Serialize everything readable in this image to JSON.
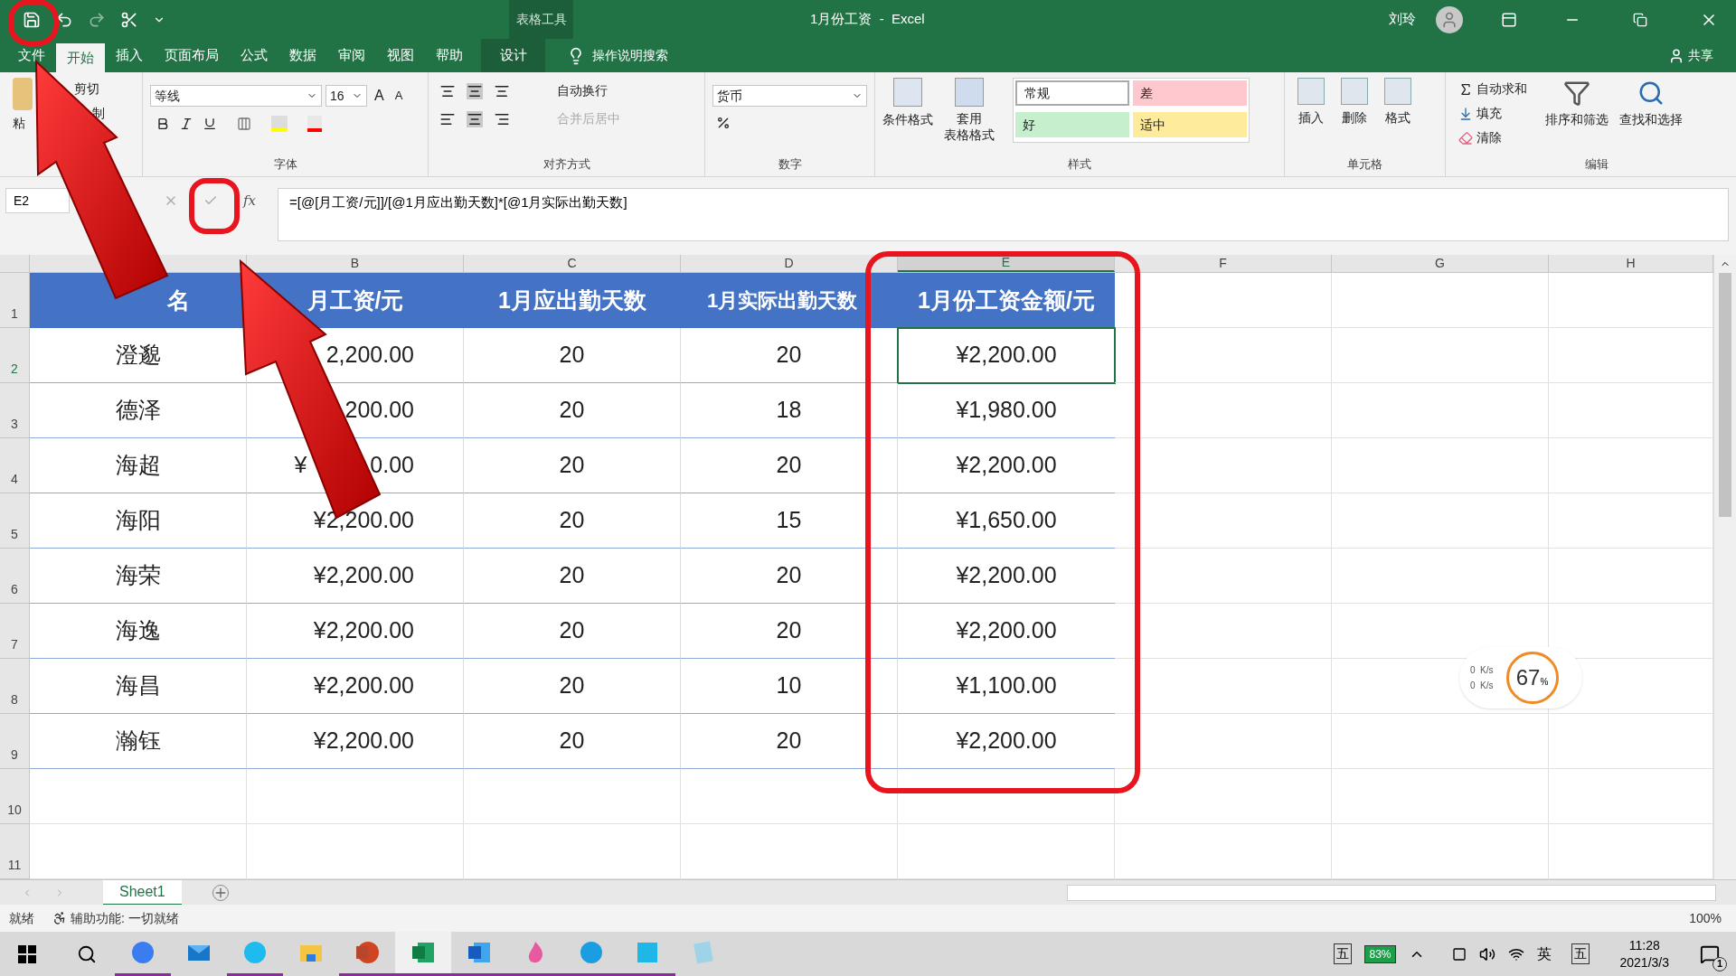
{
  "window": {
    "title": "1月份工资  -  Excel",
    "context_label": "表格工具",
    "user": "刘玲"
  },
  "menu_tabs": [
    {
      "label": "文件",
      "selected": false,
      "context": false
    },
    {
      "label": "开始",
      "selected": true,
      "context": false
    },
    {
      "label": "插入",
      "selected": false,
      "context": false
    },
    {
      "label": "页面布局",
      "selected": false,
      "context": false
    },
    {
      "label": "公式",
      "selected": false,
      "context": false
    },
    {
      "label": "数据",
      "selected": false,
      "context": false
    },
    {
      "label": "审阅",
      "selected": false,
      "context": false
    },
    {
      "label": "视图",
      "selected": false,
      "context": false
    },
    {
      "label": "帮助",
      "selected": false,
      "context": false
    },
    {
      "label": "设计",
      "selected": false,
      "context": true
    }
  ],
  "tell_me": "操作说明搜索",
  "share": "共享",
  "ribbon": {
    "clipboard": {
      "paste": "粘",
      "cut": "剪切",
      "copy": "制"
    },
    "font": {
      "name": "等线",
      "size": "16",
      "grow": "A",
      "shrink": "A",
      "label": "字体"
    },
    "alignment": {
      "wrap": "自动换行",
      "merge": "合并后居中",
      "merge_disabled": true,
      "label": "对齐方式"
    },
    "number": {
      "format": "货币",
      "label": "数字"
    },
    "styles": {
      "conditional": "条件格式",
      "table_format": [
        "套用",
        "表格格式"
      ],
      "cells": [
        {
          "label": "常规",
          "color": "#ffffff"
        },
        {
          "label": "差",
          "color": "#ffc7ce"
        },
        {
          "label": "好",
          "color": "#c6efce"
        },
        {
          "label": "适中",
          "color": "#ffeb9c"
        }
      ],
      "label": "样式"
    },
    "cells": {
      "buttons": [
        "插入",
        "删除",
        "格式"
      ],
      "label": "单元格"
    },
    "editing": {
      "autosum": "自动求和",
      "fill": "填充",
      "clear": "清除",
      "sort": "排序和筛选",
      "find": "查找和选择",
      "label": "编辑"
    }
  },
  "formula_bar": {
    "name_box": "E2",
    "fx": "fx",
    "formula": "=[@[月工资/元]]/[@1月应出勤天数]*[@1月实际出勤天数]"
  },
  "sheet": {
    "column_letters": [
      "B",
      "C",
      "D",
      "E",
      "F",
      "G",
      "H"
    ],
    "header": [
      "名",
      "月工资/元",
      "1月应出勤天数",
      "1月实际出勤天数",
      "1月份工资金额/元"
    ],
    "rows": [
      [
        "澄邈",
        "2,200.00",
        "20",
        "20",
        "¥2,200.00"
      ],
      [
        "德泽",
        "200.00",
        "20",
        "18",
        "¥1,980.00"
      ],
      [
        "海超",
        [
          "¥",
          "0.00"
        ],
        "20",
        "20",
        "¥2,200.00"
      ],
      [
        "海阳",
        "¥2,200.00",
        "20",
        "15",
        "¥1,650.00"
      ],
      [
        "海荣",
        "¥2,200.00",
        "20",
        "20",
        "¥2,200.00"
      ],
      [
        "海逸",
        "¥2,200.00",
        "20",
        "20",
        "¥2,200.00"
      ],
      [
        "海昌",
        "¥2,200.00",
        "20",
        "10",
        "¥1,100.00"
      ],
      [
        "瀚钰",
        "¥2,200.00",
        "20",
        "20",
        "¥2,200.00"
      ]
    ],
    "row_numbers": [
      "1",
      "2",
      "3",
      "4",
      "5",
      "6",
      "7",
      "8",
      "9",
      "10",
      "11"
    ]
  },
  "sheet_tabs": [
    {
      "label": "Sheet1",
      "selected": true
    }
  ],
  "status_bar": {
    "ready": "就绪",
    "accessibility": "辅助功能: 一切就绪",
    "zoom": "100%"
  },
  "net_widget": {
    "up": "0  K/s",
    "down": "0  K/s",
    "load": "67",
    "unit": "%"
  },
  "taskbar": {
    "apps": [
      {
        "kind": "Lark",
        "running": true
      },
      {
        "kind": "Mail",
        "running": false
      },
      {
        "kind": "IE",
        "running": true
      },
      {
        "kind": "Files",
        "running": false
      },
      {
        "kind": "PowerPoint",
        "running": true
      },
      {
        "kind": "Excel",
        "running": true
      },
      {
        "kind": "Word",
        "running": true
      },
      {
        "kind": "Paint",
        "running": true
      },
      {
        "kind": "Edge",
        "running": true
      },
      {
        "kind": "App",
        "running": true
      },
      {
        "kind": "Notepad",
        "running": false
      }
    ],
    "ime_left": "五",
    "battery": "83%",
    "lang": "英",
    "ime_right": "五",
    "time": "11:28",
    "date": "2021/3/3",
    "notifications": "1"
  }
}
